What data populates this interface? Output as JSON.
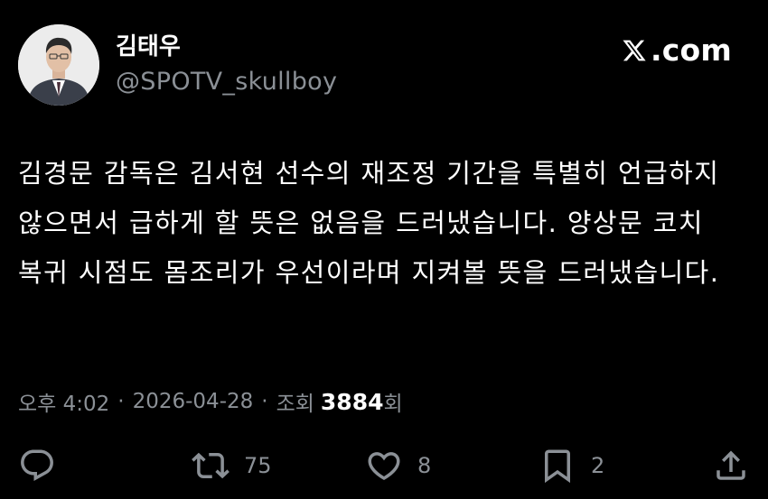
{
  "author": {
    "name": "김태우",
    "handle": "@SPOTV_skullboy"
  },
  "brand": {
    "label": ".com",
    "icon": "x-logo-icon"
  },
  "post": {
    "text": "김경문 감독은 김서현 선수의 재조정 기간을 특별히 언급하지 않으면서 급하게 할 뜻은 없음을 드러냈습니다. 양상문 코치 복귀 시점도 몸조리가 우선이라며 지켜볼 뜻을 드러냈습니다."
  },
  "meta": {
    "time": "오후 4:02",
    "separator": "·",
    "date": "2026-04-28",
    "views_label": "조회",
    "views_count": "3884",
    "views_suffix": "회"
  },
  "actions": {
    "reply": {
      "icon": "reply-icon"
    },
    "repost": {
      "icon": "repost-icon",
      "count": "75"
    },
    "like": {
      "icon": "heart-icon",
      "count": "8"
    },
    "bookmark": {
      "icon": "bookmark-icon",
      "count": "2"
    },
    "share": {
      "icon": "share-icon"
    }
  }
}
